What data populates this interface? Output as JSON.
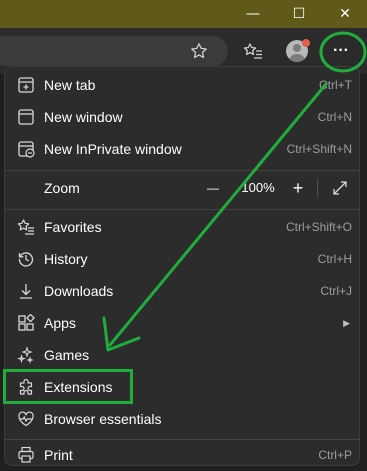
{
  "window": {
    "minimize_label": "—",
    "maximize_label": "☐",
    "close_label": "✕"
  },
  "toolbar": {
    "more_label": "···"
  },
  "menu": {
    "items": [
      {
        "label": "New tab",
        "shortcut": "Ctrl+T",
        "icon": "new-tab-icon"
      },
      {
        "label": "New window",
        "shortcut": "Ctrl+N",
        "icon": "new-window-icon"
      },
      {
        "label": "New InPrivate window",
        "shortcut": "Ctrl+Shift+N",
        "icon": "inprivate-icon"
      },
      {
        "label": "Zoom",
        "shortcut": "",
        "icon": ""
      },
      {
        "label": "Favorites",
        "shortcut": "Ctrl+Shift+O",
        "icon": "favorites-icon"
      },
      {
        "label": "History",
        "shortcut": "Ctrl+H",
        "icon": "history-icon"
      },
      {
        "label": "Downloads",
        "shortcut": "Ctrl+J",
        "icon": "downloads-icon"
      },
      {
        "label": "Apps",
        "shortcut": "",
        "icon": "apps-icon"
      },
      {
        "label": "Games",
        "shortcut": "",
        "icon": "games-icon"
      },
      {
        "label": "Extensions",
        "shortcut": "",
        "icon": "extensions-icon"
      },
      {
        "label": "Browser essentials",
        "shortcut": "",
        "icon": "browser-essentials-icon"
      },
      {
        "label": "Print",
        "shortcut": "Ctrl+P",
        "icon": "print-icon"
      }
    ],
    "zoom": {
      "minus_label": "—",
      "value": "100%",
      "plus_label": "+",
      "fullscreen_icon": "fullscreen-icon"
    },
    "apps_arrow": "▶"
  },
  "annotation": {
    "color": "#1fae3c"
  }
}
